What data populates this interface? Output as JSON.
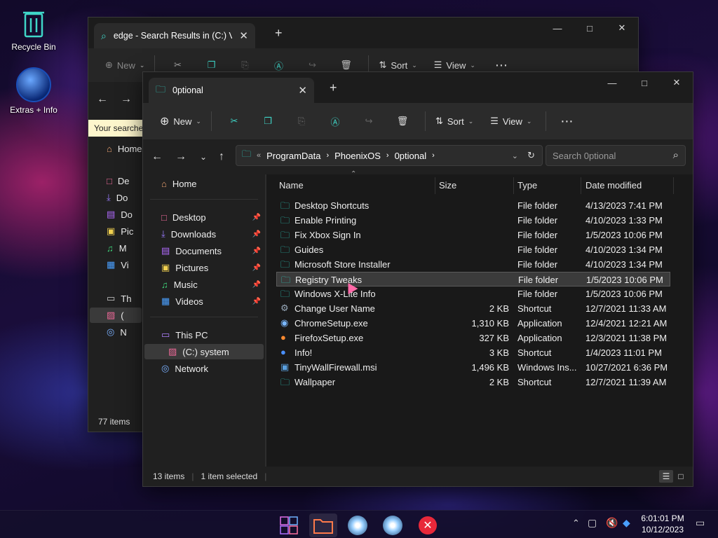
{
  "desktop": {
    "icons": [
      {
        "label": "Recycle Bin",
        "icon": "recycle-bin-icon"
      },
      {
        "label": "Extras + Info",
        "icon": "extras-info-icon"
      }
    ]
  },
  "back_window": {
    "tab_title": "edge - Search Results in (C:) V",
    "new_label": "New",
    "sort_label": "Sort",
    "view_label": "View",
    "search_notice": "Your searches",
    "nav": [
      {
        "label": "Home"
      },
      {
        "label": "De"
      },
      {
        "label": "Do"
      },
      {
        "label": "Do"
      },
      {
        "label": "Pic"
      },
      {
        "label": "M"
      },
      {
        "label": "Vi"
      },
      {
        "label": "Th"
      },
      {
        "label": "("
      },
      {
        "label": "N"
      }
    ],
    "status": "77 items"
  },
  "window": {
    "tab_title": "0ptional",
    "toolbar": {
      "new_label": "New",
      "sort_label": "Sort",
      "view_label": "View"
    },
    "breadcrumb": [
      "ProgramData",
      "PhoenixOS",
      "0ptional"
    ],
    "search_placeholder": "Search 0ptional",
    "nav": {
      "home": "Home",
      "quick": [
        {
          "label": "Desktop",
          "icon": "desktop-icon"
        },
        {
          "label": "Downloads",
          "icon": "downloads-icon"
        },
        {
          "label": "Documents",
          "icon": "documents-icon"
        },
        {
          "label": "Pictures",
          "icon": "pictures-icon"
        },
        {
          "label": "Music",
          "icon": "music-icon"
        },
        {
          "label": "Videos",
          "icon": "videos-icon"
        }
      ],
      "this_pc": "This PC",
      "drive": "(C:) system",
      "network": "Network"
    },
    "columns": {
      "name": "Name",
      "size": "Size",
      "type": "Type",
      "date": "Date modified"
    },
    "files": [
      {
        "name": "Desktop Shortcuts",
        "size": "",
        "type": "File folder",
        "date": "4/13/2023 7:41 PM",
        "icon": "folder-icon"
      },
      {
        "name": "Enable Printing",
        "size": "",
        "type": "File folder",
        "date": "4/10/2023 1:33 PM",
        "icon": "folder-icon"
      },
      {
        "name": "Fix Xbox Sign In",
        "size": "",
        "type": "File folder",
        "date": "1/5/2023 10:06 PM",
        "icon": "folder-icon"
      },
      {
        "name": "Guides",
        "size": "",
        "type": "File folder",
        "date": "4/10/2023 1:34 PM",
        "icon": "folder-icon"
      },
      {
        "name": "Microsoft Store Installer",
        "size": "",
        "type": "File folder",
        "date": "4/10/2023 1:34 PM",
        "icon": "folder-icon"
      },
      {
        "name": "Registry Tweaks",
        "size": "",
        "type": "File folder",
        "date": "1/5/2023 10:06 PM",
        "icon": "folder-icon",
        "selected": true
      },
      {
        "name": "Windows X-Lite Info",
        "size": "",
        "type": "File folder",
        "date": "1/5/2023 10:06 PM",
        "icon": "folder-icon"
      },
      {
        "name": "Change User Name",
        "size": "2 KB",
        "type": "Shortcut",
        "date": "12/7/2021 11:33 AM",
        "icon": "shortcut-icon"
      },
      {
        "name": "ChromeSetup.exe",
        "size": "1,310 KB",
        "type": "Application",
        "date": "12/4/2021 12:21 AM",
        "icon": "installer-icon"
      },
      {
        "name": "FirefoxSetup.exe",
        "size": "327 KB",
        "type": "Application",
        "date": "12/3/2021 11:38 PM",
        "icon": "firefox-icon"
      },
      {
        "name": "Info!",
        "size": "3 KB",
        "type": "Shortcut",
        "date": "1/4/2023 11:01 PM",
        "icon": "info-icon"
      },
      {
        "name": "TinyWallFirewall.msi",
        "size": "1,496 KB",
        "type": "Windows Ins...",
        "date": "10/27/2021 6:36 PM",
        "icon": "msi-icon"
      },
      {
        "name": "Wallpaper",
        "size": "2 KB",
        "type": "Shortcut",
        "date": "12/7/2021 11:39 AM",
        "icon": "folder-icon"
      }
    ],
    "status": {
      "items": "13 items",
      "selected": "1 item selected"
    }
  },
  "taskbar": {
    "time": "6:01:01 PM",
    "date": "10/12/2023"
  },
  "colors": {
    "folder_accent": "#2fd4c4",
    "background_window": "#202020",
    "selection": "#3b3b3b"
  }
}
